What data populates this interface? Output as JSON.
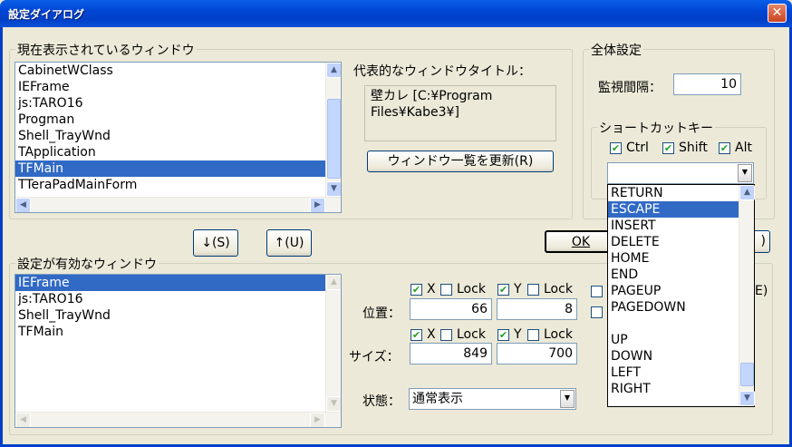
{
  "window": {
    "title": "設定ダイアログ",
    "close": "✕"
  },
  "current_windows": {
    "label": "現在表示されているウィンドウ",
    "items": [
      "CabinetWClass",
      "IEFrame",
      "js:TARO16",
      "Progman",
      "Shell_TrayWnd",
      "TApplication",
      "TFMain",
      "TTeraPadMainForm"
    ],
    "selected": "TFMain"
  },
  "representative": {
    "label": "代表的なウィンドウタイトル：",
    "value": "壁カレ [C:¥Program Files¥Kabe3¥]"
  },
  "refresh_button": "ウィンドウ一覧を更新(R)",
  "global": {
    "label": "全体設定",
    "interval_label": "監視間隔：",
    "interval_value": "10",
    "shortcut_label": "ショートカットキー",
    "ctrl": "Ctrl",
    "shift": "Shift",
    "alt": "Alt",
    "key_value": ""
  },
  "move_down_button": "↓(S)",
  "move_up_button": "↑(U)",
  "ok_button": "OK",
  "effective_windows": {
    "label": "設定が有効なウィンドウ",
    "items": [
      "IEFrame",
      "js:TARO16",
      "Shell_TrayWnd",
      "TFMain"
    ],
    "selected": "IEFrame"
  },
  "position": {
    "label": "位置：",
    "x_label": "X",
    "y_label": "Y",
    "lock_label": "Lock",
    "x_value": "66",
    "y_value": "8"
  },
  "size": {
    "label": "サイズ：",
    "x_label": "X",
    "y_label": "Y",
    "lock_label": "Lock",
    "x_value": "849",
    "y_value": "700"
  },
  "state": {
    "label": "状態：",
    "value": "通常表示"
  },
  "hidden_right": {
    "paren_e": "E)",
    "paren_other": ")"
  },
  "key_dropdown": {
    "items": [
      "RETURN",
      "ESCAPE",
      "INSERT",
      "DELETE",
      "HOME",
      "END",
      "PAGEUP",
      "PAGEDOWN",
      "",
      "UP",
      "DOWN",
      "LEFT",
      "RIGHT"
    ],
    "selected": "ESCAPE"
  }
}
